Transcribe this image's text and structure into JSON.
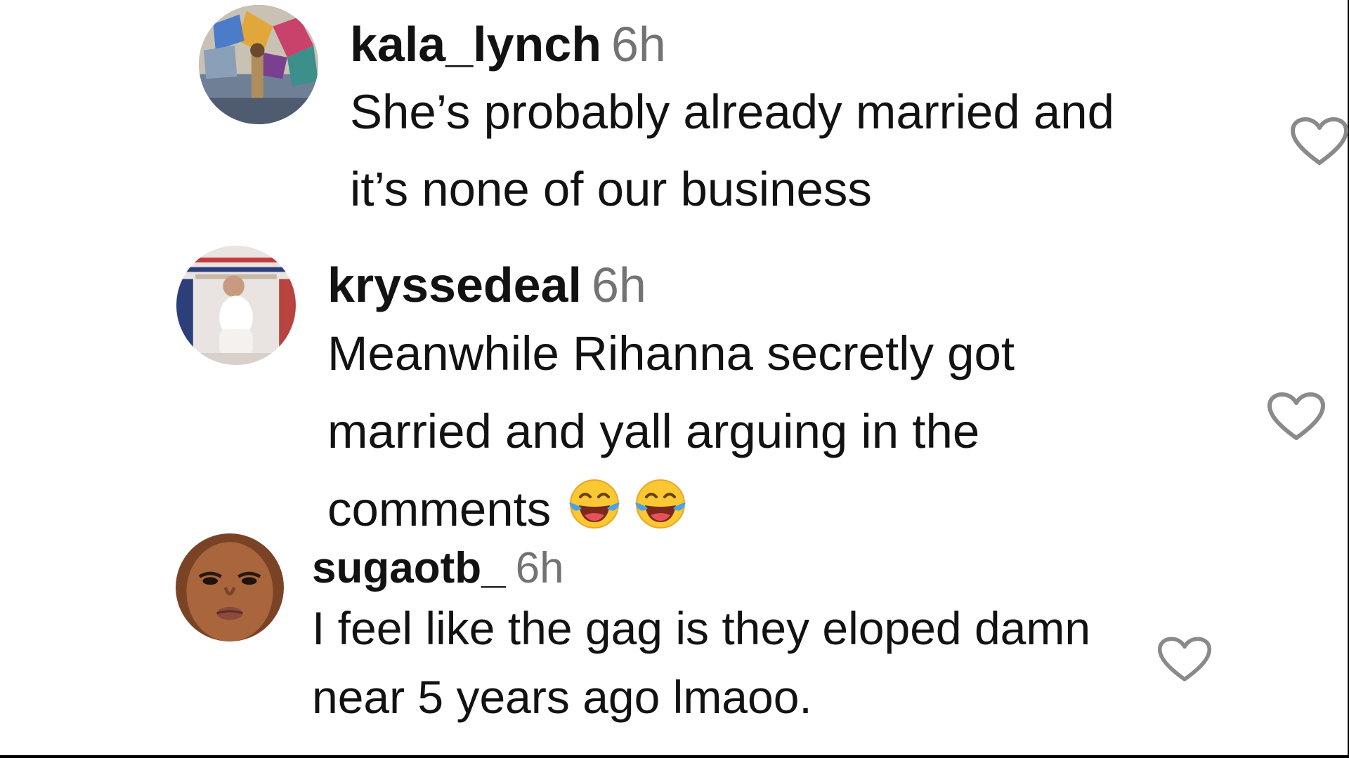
{
  "comments": [
    {
      "username": "kala_lynch",
      "timestamp": "6h",
      "lines": [
        "She’s probably already married and",
        "it’s none of our business"
      ],
      "avatar_icon": "avatar-photo-colorful-mural",
      "like_icon": "heart-outline-icon"
    },
    {
      "username": "kryssedeal",
      "timestamp": "6h",
      "lines": [
        "Meanwhile Rihanna secretly got",
        "married and yall arguing in the",
        "comments"
      ],
      "emojis": [
        "face-with-tears-of-joy",
        "face-with-tears-of-joy"
      ],
      "avatar_icon": "avatar-photo-white-outfit",
      "like_icon": "heart-outline-icon"
    },
    {
      "username": "sugaotb_",
      "timestamp": "6h",
      "lines": [
        "I feel like the gag is they eloped damn",
        "near 5 years ago lmaoo."
      ],
      "avatar_icon": "avatar-photo-face",
      "like_icon": "heart-outline-icon"
    }
  ],
  "colors": {
    "username": "#121212",
    "timestamp": "#737373",
    "text": "#121212",
    "heart_stroke": "#8a8a8a",
    "background": "#ffffff"
  }
}
